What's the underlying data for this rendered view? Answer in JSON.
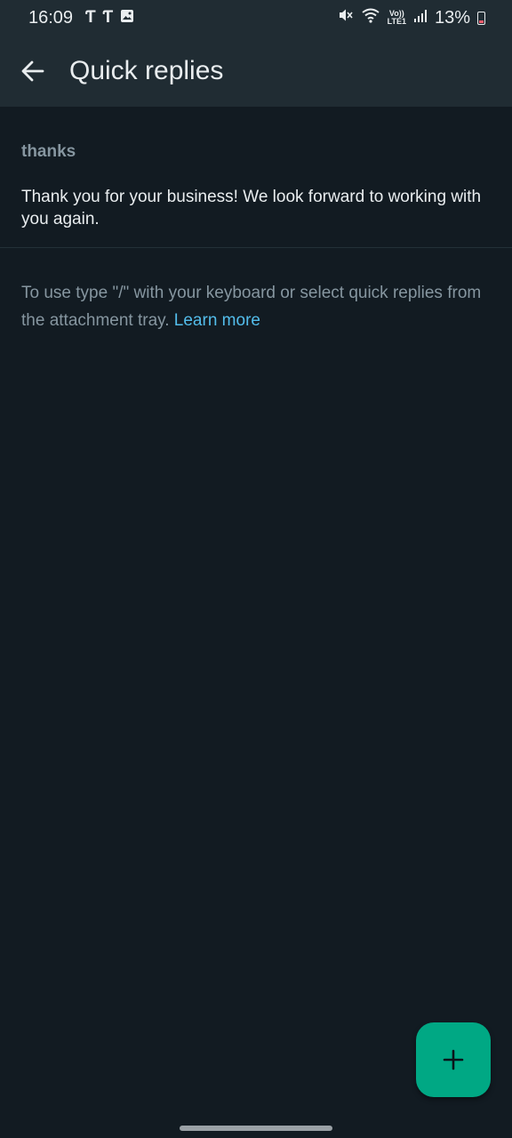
{
  "status_bar": {
    "time": "16:09",
    "notification_icons": [
      "t-app-icon",
      "t-app-icon",
      "gallery-icon"
    ],
    "volte_top": "Vo))",
    "volte_bottom": "LTE1",
    "battery_percent": "13%",
    "battery_level": 0.13
  },
  "app_bar": {
    "title": "Quick replies"
  },
  "quick_replies": [
    {
      "shortcut": "thanks",
      "message": "Thank you for your business! We look forward to working with you again."
    }
  ],
  "hint": {
    "text": "To use type \"/\" with your keyboard or select quick replies from the attachment tray.",
    "link": "Learn more"
  },
  "fab": {
    "icon": "plus-icon"
  },
  "colors": {
    "background": "#121b22",
    "bar": "#202c33",
    "accent": "#00a884",
    "link": "#53bdeb",
    "secondary_text": "#8696a0",
    "primary_text": "#e9edef"
  }
}
